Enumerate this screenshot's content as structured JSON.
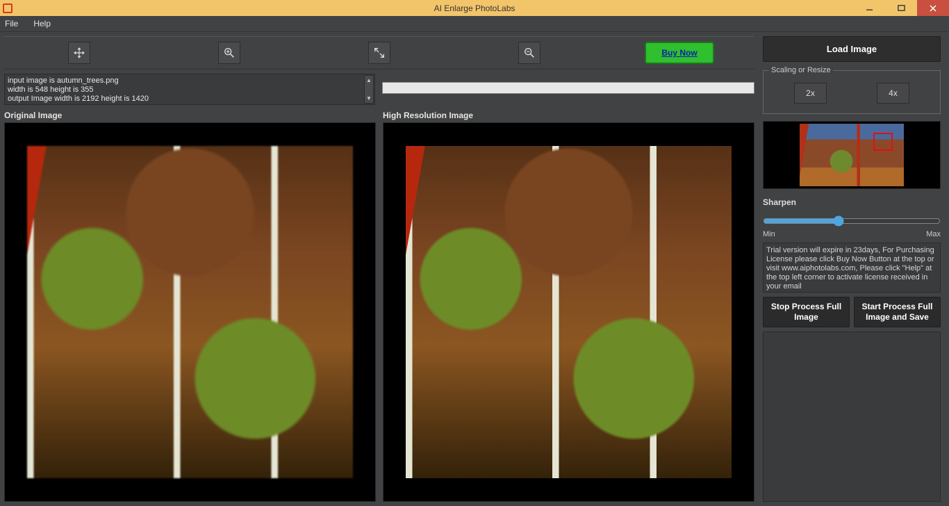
{
  "window": {
    "title": "AI Enlarge PhotoLabs"
  },
  "menu": {
    "file": "File",
    "help": "Help"
  },
  "toolbar": {
    "buy_label": "Buy Now"
  },
  "info": {
    "line1": "input image is autumn_trees.png",
    "line2": "width is 548 height is 355",
    "line3": "output Image width is 2192 height is 1420"
  },
  "labels": {
    "original": "Original Image",
    "highres": "High Resolution Image"
  },
  "right_panel": {
    "load_label": "Load Image",
    "scaling_legend": "Scaling or Resize",
    "scale_2x": "2x",
    "scale_4x": "4x",
    "sharpen_label": "Sharpen",
    "min": "Min",
    "max": "Max",
    "trial_text": "Trial version will expire in 23days, For Purchasing License please click Buy Now Button at the top or visit www.aiphotolabs.com, Please click \"Help\" at the top left corner to activate license received in your email",
    "stop_label": "Stop Process Full Image",
    "start_label": "Start Process Full Image and Save"
  }
}
